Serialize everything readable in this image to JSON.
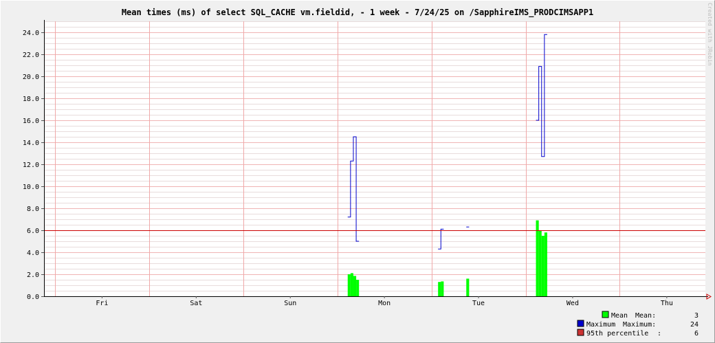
{
  "chart_data": {
    "type": "bar",
    "title": "Mean times (ms) of  select SQL_CACHE vm.fieldid,  - 1 week - 7/24/25 on /SapphireIMS_PRODCIMSAPP1",
    "watermark": "Created with JRobin",
    "x_day_labels": [
      "Fri",
      "Sat",
      "Sun",
      "Mon",
      "Tue",
      "Wed",
      "Thu"
    ],
    "ylim": [
      0,
      25
    ],
    "y_tick_labels": [
      "0.0",
      "2.0",
      "4.0",
      "6.0",
      "8.0",
      "10.0",
      "12.0",
      "14.0",
      "16.0",
      "18.0",
      "20.0",
      "22.0",
      "24.0"
    ],
    "grid": true,
    "series": [
      {
        "name": "Mean",
        "kind": "bars",
        "color": "#00ff00",
        "points": [
          {
            "t": 3.11,
            "v": 2.0
          },
          {
            "t": 3.14,
            "v": 2.1
          },
          {
            "t": 3.17,
            "v": 1.85
          },
          {
            "t": 3.2,
            "v": 1.5
          },
          {
            "t": 4.07,
            "v": 1.3
          },
          {
            "t": 4.1,
            "v": 1.35
          },
          {
            "t": 4.37,
            "v": 1.6
          },
          {
            "t": 5.11,
            "v": 6.9
          },
          {
            "t": 5.14,
            "v": 6.0
          },
          {
            "t": 5.17,
            "v": 5.5
          },
          {
            "t": 5.2,
            "v": 5.8
          }
        ]
      },
      {
        "name": "Maximum",
        "kind": "step",
        "color": "#0000cc",
        "segments": [
          [
            {
              "t": 3.11,
              "v": 7.2
            },
            {
              "t": 3.14,
              "v": 12.3
            },
            {
              "t": 3.17,
              "v": 14.5
            },
            {
              "t": 3.2,
              "v": 5.0
            },
            {
              "t": 3.23,
              "v": null
            }
          ],
          [
            {
              "t": 4.07,
              "v": 4.3
            },
            {
              "t": 4.1,
              "v": 6.1
            },
            {
              "t": 4.13,
              "v": null
            }
          ],
          [
            {
              "t": 4.37,
              "v": 6.3
            },
            {
              "t": 4.4,
              "v": null
            }
          ],
          [
            {
              "t": 5.11,
              "v": 16.0
            },
            {
              "t": 5.14,
              "v": 20.9
            },
            {
              "t": 5.17,
              "v": 12.7
            },
            {
              "t": 5.2,
              "v": 23.8
            },
            {
              "t": 5.23,
              "v": null
            }
          ]
        ]
      },
      {
        "name": "95th percentile",
        "kind": "hline",
        "color": "#cc0000",
        "value": 6.0
      }
    ],
    "legend": {
      "placement": "bottom-right",
      "entries": [
        {
          "swatch": "#00ff00",
          "name": "Mean",
          "stat_label": "Mean:",
          "stat_value": "3"
        },
        {
          "swatch": "#0000cc",
          "name": "Maximum",
          "stat_label": "Maximum:",
          "stat_value": "24"
        },
        {
          "swatch": "#cc3333",
          "name": "95th percentile",
          "stat_label": ":",
          "stat_value": "6"
        }
      ]
    }
  }
}
